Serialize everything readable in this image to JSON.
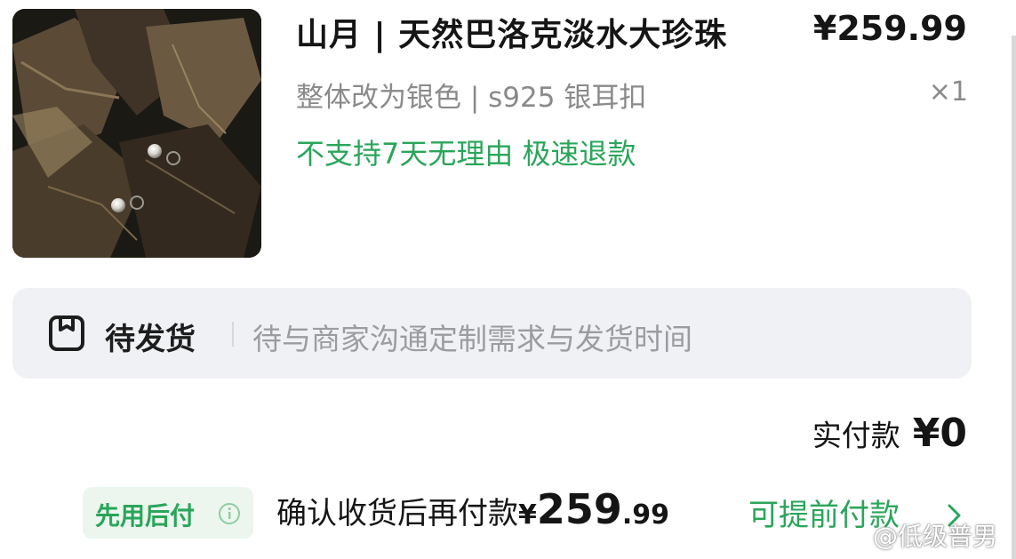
{
  "product": {
    "title": "山月 | 天然巴洛克淡水大珍珠",
    "price": "¥259.99",
    "variant": "整体改为银色 | s925 银耳扣",
    "quantity": "×1",
    "policy": "不支持7天无理由  极速退款",
    "image_icon": "pearl-earrings-on-leaves"
  },
  "status": {
    "icon": "package-box-icon",
    "label": "待发货",
    "description": "待与商家沟通定制需求与发货时间"
  },
  "payment": {
    "paid_label": "实付款",
    "paid_amount": "¥0",
    "bnpl_tag": "先用后付",
    "bnpl_icon": "info-icon",
    "pay_later_label": "确认收货后再付款",
    "currency": "¥",
    "pay_later_integer": "259",
    "pay_later_decimal": ".99",
    "pay_early_link": "可提前付款",
    "pay_early_icon": "chevron-right-icon"
  },
  "watermark": {
    "icon": "weibo-icon",
    "text": "@低级普男"
  },
  "colors": {
    "accent_green": "#2aa55a",
    "text_dark": "#151515",
    "text_gray": "#8a8a8a",
    "status_bg": "#eff1f4"
  }
}
